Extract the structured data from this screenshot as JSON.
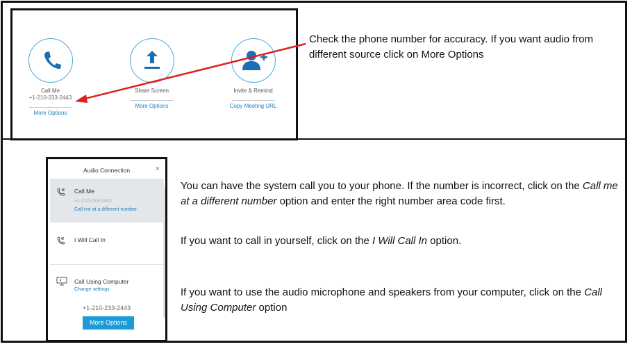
{
  "meeting_panel": {
    "actions": [
      {
        "label": "Call Me",
        "sub": "+1-210-233-2443",
        "link": "More Options",
        "icon": "phone-icon"
      },
      {
        "label": "Share Screen",
        "sub": "",
        "link": "More Options",
        "icon": "upload-icon"
      },
      {
        "label": "Invite & Remind",
        "sub": "",
        "link": "Copy Meeting URL",
        "icon": "add-person-icon"
      }
    ]
  },
  "notes": {
    "top": "Check the phone number for accuracy.  If you want audio from different source click on More Options",
    "call_me_1": "You can have the system call you to your phone.  If the number is incorrect, click on the ",
    "call_me_em": "Call me at a different number",
    "call_me_2": " option and enter the right number area code first.",
    "call_in_1": "If you want to call in yourself, click on the ",
    "call_in_em": "I Will Call In",
    "call_in_2": " option.",
    "computer_1": "If you want to use the audio microphone and speakers from your computer, click on the ",
    "computer_em": "Call Using Computer",
    "computer_2": " option"
  },
  "dialog": {
    "title": "Audio Connection",
    "close": "×",
    "options": [
      {
        "label": "Call Me",
        "number": "+1-210-233-2443",
        "link": "Call me at a different number",
        "selected": true,
        "icon": "callback-phone-icon"
      },
      {
        "label": "I Will Call In",
        "icon": "incoming-call-icon"
      },
      {
        "label": "Call Using Computer",
        "link": "Change settings",
        "icon": "computer-audio-icon"
      }
    ],
    "bottom_number": "+1-210-233-2443",
    "more_options_button": "More Options"
  },
  "colors": {
    "accent": "#1d9bd8",
    "link": "#1a7fc2",
    "arrow": "#e0201d"
  }
}
